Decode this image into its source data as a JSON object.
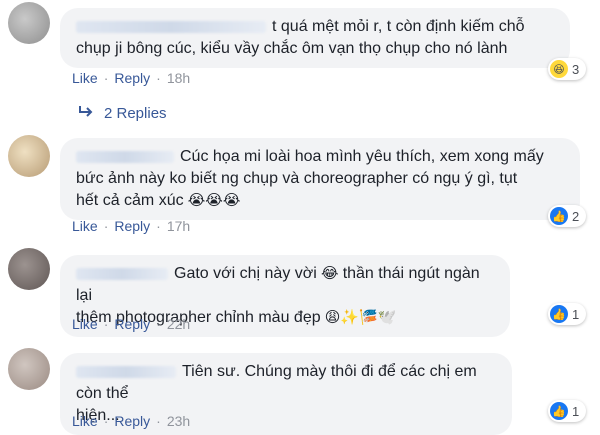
{
  "comments": [
    {
      "text_line1": "t quá mệt mỏi r, t còn định kiếm chỗ",
      "text_line2": "chụp ji bông cúc, kiểu vầy chắc ôm vạn thọ chụp cho nó lành",
      "like_label": "Like",
      "reply_label": "Reply",
      "time": "18h",
      "reaction_type": "haha",
      "reaction_count": "3"
    },
    {
      "text_line1": "Cúc họa mi loài hoa mình yêu thích, xem xong mấy",
      "text_line2": "bức ảnh này ko biết ng chụp và choreographer có ngụ ý gì, tụt",
      "text_line3": "hết cả cảm xúc",
      "like_label": "Like",
      "reply_label": "Reply",
      "time": "17h",
      "reaction_type": "like",
      "reaction_count": "2"
    },
    {
      "text_line1": "Gato với chị này vời",
      "text_line1b": "thần thái ngút ngàn lại",
      "text_line2": "thêm photographer chỉnh màu đẹp",
      "like_label": "Like",
      "reply_label": "Reply",
      "time": "22h",
      "reaction_type": "like",
      "reaction_count": "1"
    },
    {
      "text_line1": "Tiên sư. Chúng mày thôi đi để các chị em còn thể",
      "text_line2": "hiện...",
      "like_label": "Like",
      "reply_label": "Reply",
      "time": "23h",
      "reaction_type": "like",
      "reaction_count": "1"
    }
  ],
  "replies_link": "2 Replies",
  "icons": {
    "reply_arrow": "reply-arrow-icon",
    "haha": "haha-reaction-icon",
    "like": "like-reaction-icon"
  },
  "colors": {
    "link": "#385898",
    "bubble": "#f2f3f5",
    "like_blue": "#1877f2"
  }
}
